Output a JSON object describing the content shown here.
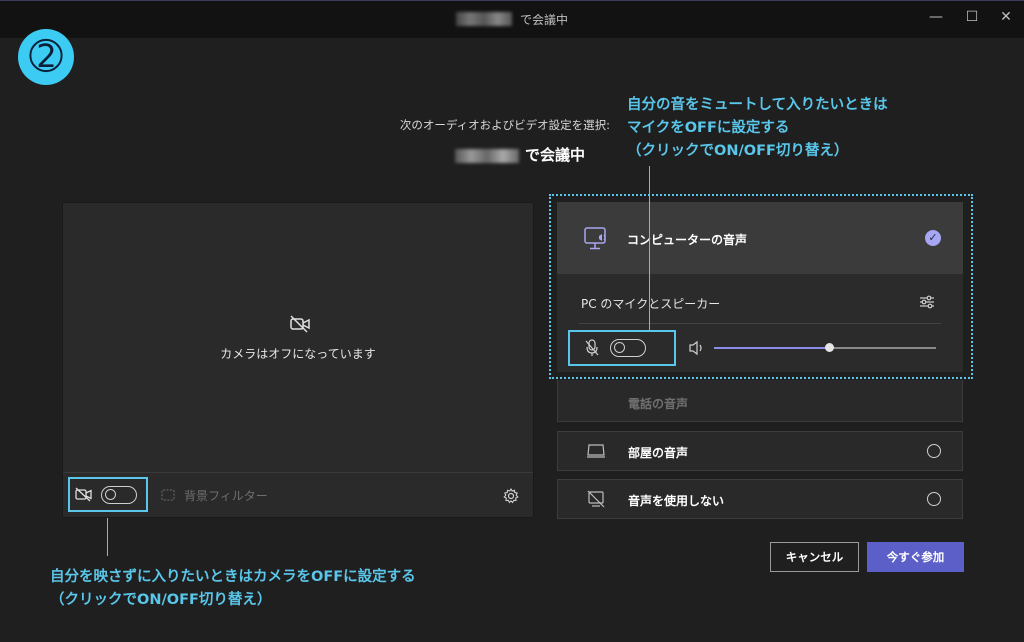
{
  "window": {
    "title": "で会議中",
    "controls": {
      "minimize": "—",
      "maximize": "☐",
      "close": "✕"
    }
  },
  "step_badge": "➁",
  "prompt": "次のオーディオおよびビデオ設定を選択:",
  "meeting_status": "で会議中",
  "video": {
    "camera_off_text": "カメラはオフになっています",
    "background_filter_label": "背景フィルター",
    "camera_toggle": "off"
  },
  "audio": {
    "options": [
      {
        "label": "コンピューターの音声",
        "icon": "computer-audio-icon",
        "selected": true
      },
      {
        "label": "電話の音声",
        "icon": "phone-icon",
        "selected": false
      },
      {
        "label": "部屋の音声",
        "icon": "room-icon",
        "selected": false
      },
      {
        "label": "音声を使用しない",
        "icon": "no-audio-icon",
        "selected": false
      }
    ],
    "device_label": "PC のマイクとスピーカー",
    "mic_toggle": "off",
    "volume_level": 0.52
  },
  "buttons": {
    "cancel": "キャンセル",
    "join": "今すぐ参加"
  },
  "annotations": {
    "mic_note": [
      "自分の音をミュートして入りたいときは",
      "マイクをOFFに設定する",
      "（クリックでON/OFF切り替え）"
    ],
    "camera_note": [
      "自分を映さずに入りたいときはカメラをOFFに設定する",
      "（クリックでON/OFF切り替え）"
    ]
  },
  "colors": {
    "accent": "#59c6ea",
    "primary_button": "#5b5fc7",
    "check": "#a7a6f2"
  }
}
